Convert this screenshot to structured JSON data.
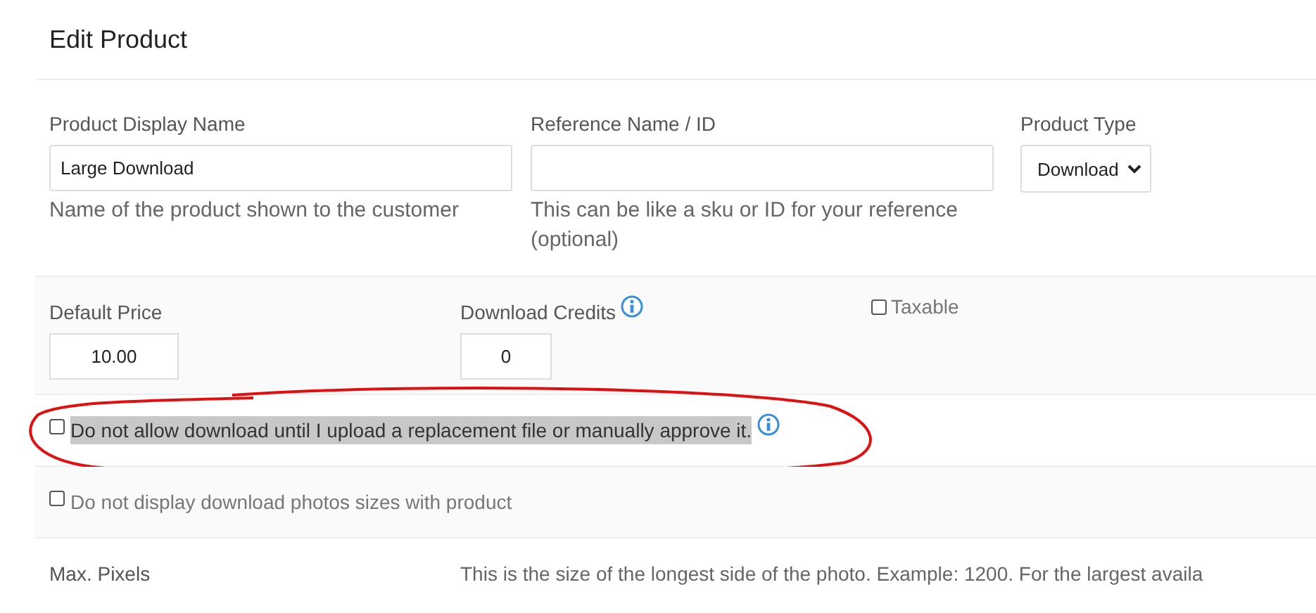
{
  "title": "Edit Product",
  "fields": [
    {
      "label": "Product Display Name",
      "kind": "text",
      "value": "Large Download",
      "help": "Name of the product shown to the customer"
    },
    {
      "label": "Reference Name / ID",
      "kind": "text",
      "help": "This can be like a sku or ID for your reference (optional)"
    },
    {
      "label": "Product Type",
      "kind": "select",
      "value": "Download"
    }
  ],
  "pricing": [
    {
      "label": "Default Price",
      "kind": "number",
      "value": "10.00",
      "info": false
    },
    {
      "label": "Download Credits",
      "kind": "number",
      "value": "0",
      "info": true
    },
    {
      "label": "Taxable",
      "kind": "checkbox",
      "checked": false
    }
  ],
  "options": [
    {
      "label": "Do not allow download until I upload a replacement file or manually approve it.",
      "checked": false,
      "highlighted": true,
      "info": true,
      "circled": true
    },
    {
      "label": "Do not display download photos sizes with product",
      "checked": false,
      "highlighted": false,
      "info": false,
      "circled": false
    }
  ],
  "max_pixels": {
    "label": "Max. Pixels",
    "help": "This is the size of the longest side of the photo. Example: 1200. For the largest availa"
  }
}
